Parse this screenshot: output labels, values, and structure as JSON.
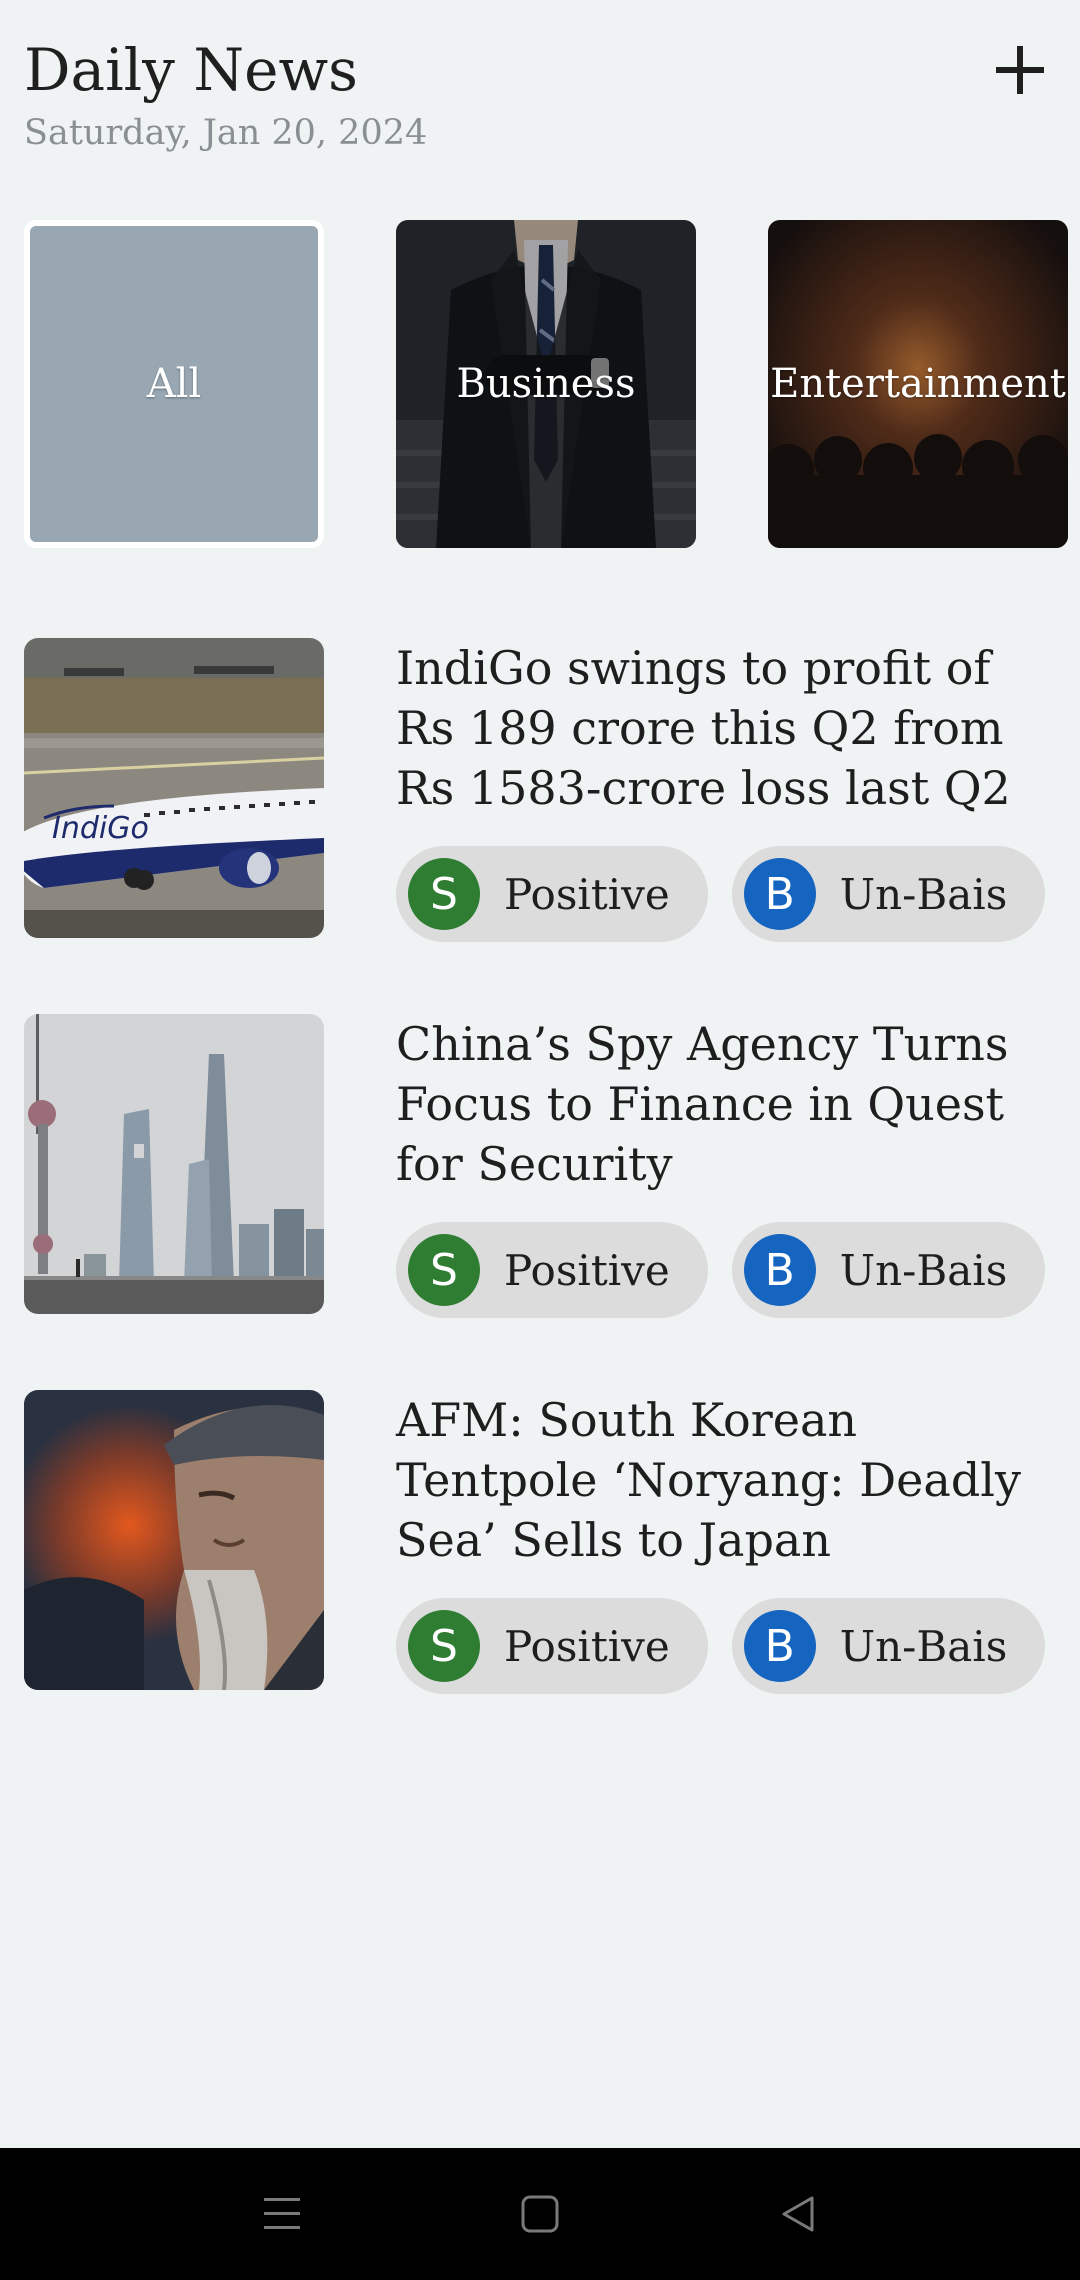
{
  "header": {
    "title": "Daily News",
    "date": "Saturday, Jan 20, 2024",
    "add_icon": "plus-icon"
  },
  "categories": [
    {
      "label": "All",
      "selected": true
    },
    {
      "label": "Business",
      "selected": false
    },
    {
      "label": "Entertainment",
      "selected": false
    }
  ],
  "articles": [
    {
      "headline": "IndiGo swings to profit of Rs 189 crore this Q2 from Rs 1583-crore loss last Q2",
      "sentiment": {
        "letter": "S",
        "label": "Positive",
        "color": "#2e7d32"
      },
      "bias": {
        "letter": "B",
        "label": "Un-Bais",
        "color": "#1565c0"
      }
    },
    {
      "headline": "China’s Spy Agency Turns Focus to Finance in Quest for Security",
      "sentiment": {
        "letter": "S",
        "label": "Positive",
        "color": "#2e7d32"
      },
      "bias": {
        "letter": "B",
        "label": "Un-Bais",
        "color": "#1565c0"
      }
    },
    {
      "headline": "AFM: South Korean Tentpole ‘Noryang: Deadly Sea’ Sells to Japan",
      "sentiment": {
        "letter": "S",
        "label": "Positive",
        "color": "#2e7d32"
      },
      "bias": {
        "letter": "B",
        "label": "Un-Bais",
        "color": "#1565c0"
      }
    }
  ],
  "navbar": {
    "icons": [
      "menu-icon",
      "home-square-icon",
      "back-triangle-icon"
    ]
  },
  "colors": {
    "background": "#eff3f4",
    "selected_category": "#98a7b2",
    "chip_background": "#dcdcdc",
    "positive": "#2e7d32",
    "unbiased": "#1565c0"
  }
}
